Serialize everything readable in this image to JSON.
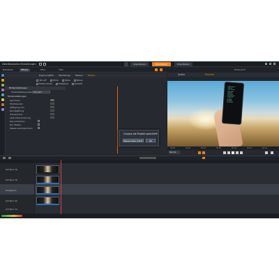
{
  "app": {
    "menu": [
      "Datei",
      "Bearbeiten",
      "Einstellungen"
    ],
    "mode_tabs": [
      {
        "label": "Importieren",
        "active": false
      },
      {
        "label": "Bearbeiten",
        "active": true
      },
      {
        "label": "Exportieren",
        "active": false
      }
    ]
  },
  "library": {
    "tabs": [
      "Bibliothek",
      "Effekte",
      "Filter",
      "Titel"
    ]
  },
  "effects_panel": {
    "header_items": [
      "Eigenschaften",
      "Werkzeuge",
      "Medien",
      "Effekte"
    ],
    "sub_options": [
      "3D-LUT",
      "Filme",
      "Farbe",
      "Blaue",
      "Farbkontrast",
      "Helligkeit",
      "Schärfe"
    ],
    "section_title": "Bildeinstellungen",
    "preset_label": "Voreinstellung laden",
    "preset_value": "Standard",
    "group_label": "Farbeinstellungen",
    "settings": [
      {
        "label": "Key Farbe",
        "color": "#3cc23c"
      },
      {
        "label": "Farbtoleranz"
      },
      {
        "label": "Sättigung min."
      },
      {
        "label": "Randglättung"
      },
      {
        "label": "Transparenz"
      },
      {
        "label": "Spill-Unterdrückung"
      },
      {
        "label": "Key umkehren"
      },
      {
        "label": "Nur Maske"
      },
      {
        "label": "Maske weichzeichnen"
      }
    ]
  },
  "dialog": {
    "title": "Gruppe als Projekt speichern",
    "primary": "Neues Video (16:9)",
    "secondary": "OK"
  },
  "preview": {
    "header_right": "00:00:12:15",
    "tabs": [
      "Quelle",
      "Timeline"
    ],
    "phone_text": "Lorem ipsum\ndolor sit\namet consec\ntetur adipi\nscing elit\nsed do eiu\nsmod tempor\nincididunt\nut labore\net dolore\nmagna aliq",
    "ruler_labels": [
      "00:00",
      "00:02",
      "00:04",
      "00:06",
      "00:08",
      "00:10",
      "00:12"
    ],
    "quality": "Normal"
  },
  "timeline": {
    "tracks": [
      {
        "name": "A/V Spur (4)",
        "selected": false
      },
      {
        "name": "A/V Spur (3)",
        "selected": false
      },
      {
        "name": "Gruppieren",
        "selected": true
      },
      {
        "name": "A/V Spur (2)",
        "selected": false
      },
      {
        "name": "A/V Spur (1)",
        "selected": false
      }
    ]
  },
  "colors": {
    "accent": "#f0821e",
    "audio_clip": "#2f6fbd",
    "selected_track": "#3a3f47"
  }
}
